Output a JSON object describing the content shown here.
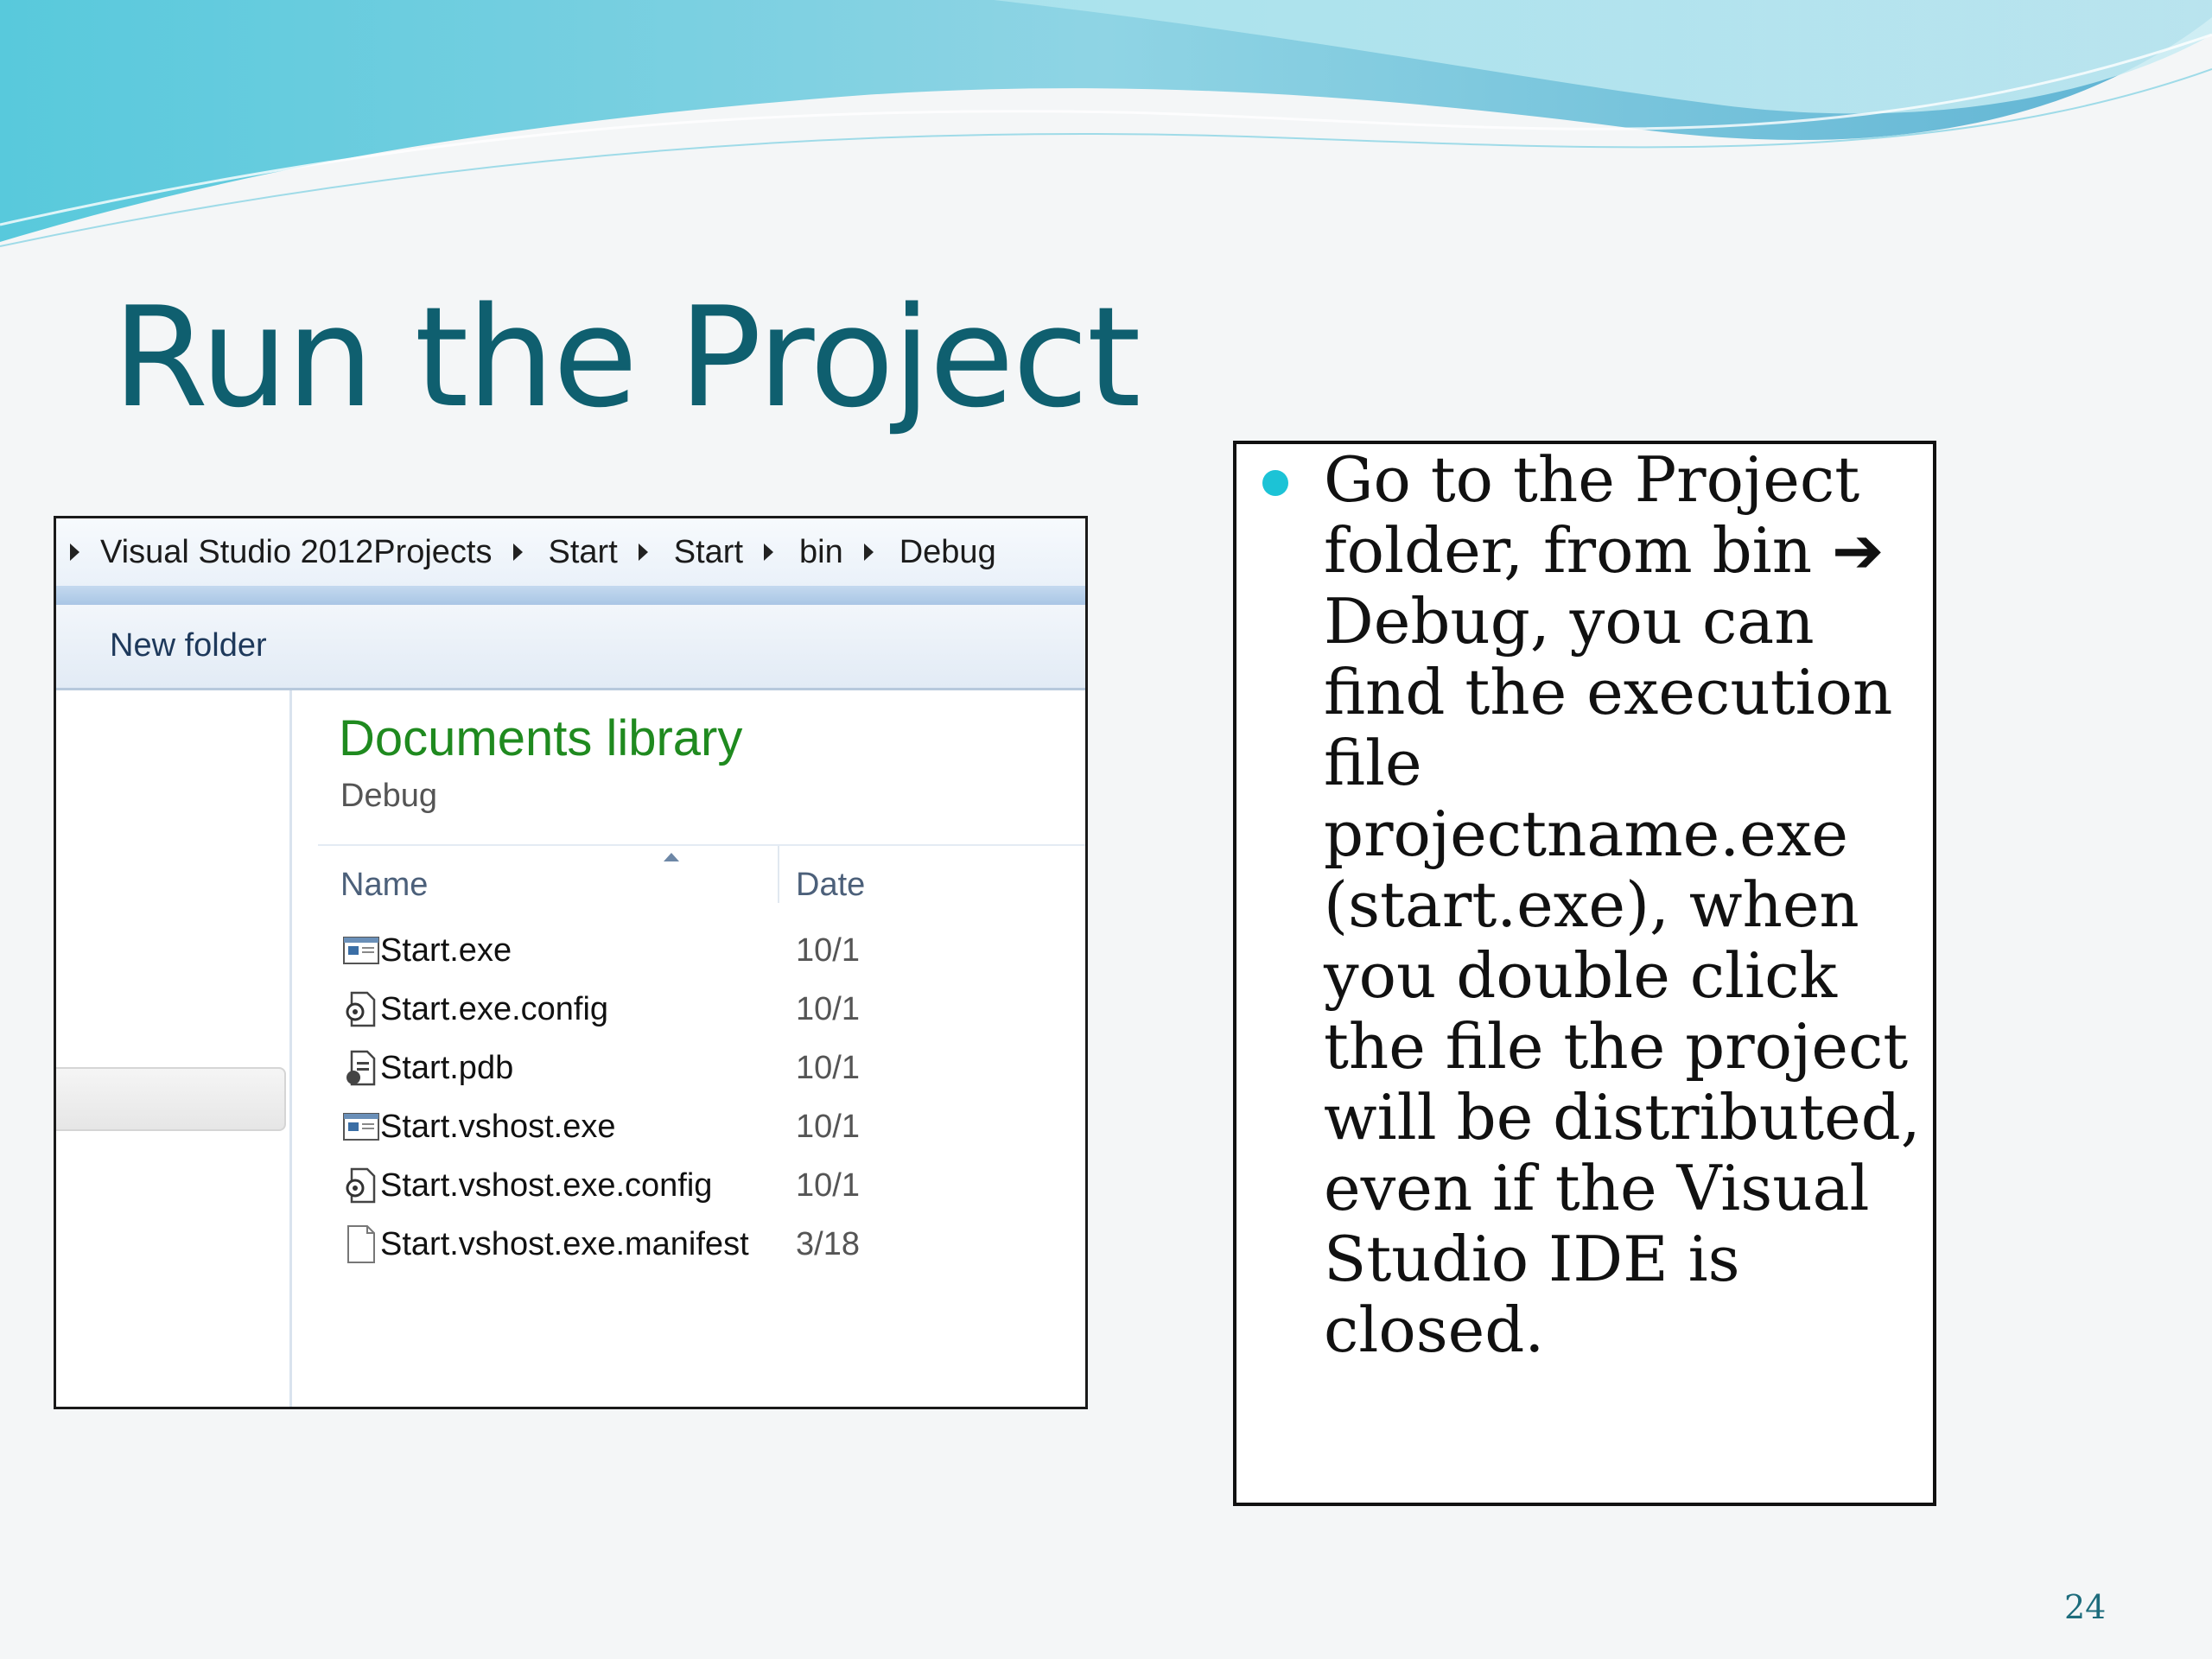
{
  "slide": {
    "title": "Run the Project",
    "page_number": "24",
    "accent_color": "#1cc3d6",
    "title_color": "#0f5f6f"
  },
  "explorer": {
    "breadcrumb": [
      "Visual Studio 2012",
      "Projects",
      "Start",
      "Start",
      "bin",
      "Debug"
    ],
    "toolbar": {
      "new_folder_label": "New folder"
    },
    "library_title": "Documents library",
    "library_subtitle": "Debug",
    "columns": {
      "name": "Name",
      "date": "Date"
    },
    "files": [
      {
        "name": "Start.exe",
        "date": "10/1",
        "icon": "exe-icon"
      },
      {
        "name": "Start.exe.config",
        "date": "10/1",
        "icon": "config-icon"
      },
      {
        "name": "Start.pdb",
        "date": "10/1",
        "icon": "pdb-icon"
      },
      {
        "name": "Start.vshost.exe",
        "date": "10/1",
        "icon": "exe-icon"
      },
      {
        "name": "Start.vshost.exe.config",
        "date": "10/1",
        "icon": "config-icon"
      },
      {
        "name": "Start.vshost.exe.manifest",
        "date": "3/18",
        "icon": "blank-file-icon"
      }
    ]
  },
  "note": {
    "text": "Go to the Project folder, from bin ➔ Debug, you can find the execution file projectname.exe (start.exe), when you double click the file the project will be distributed, even if the Visual Studio IDE is closed."
  }
}
